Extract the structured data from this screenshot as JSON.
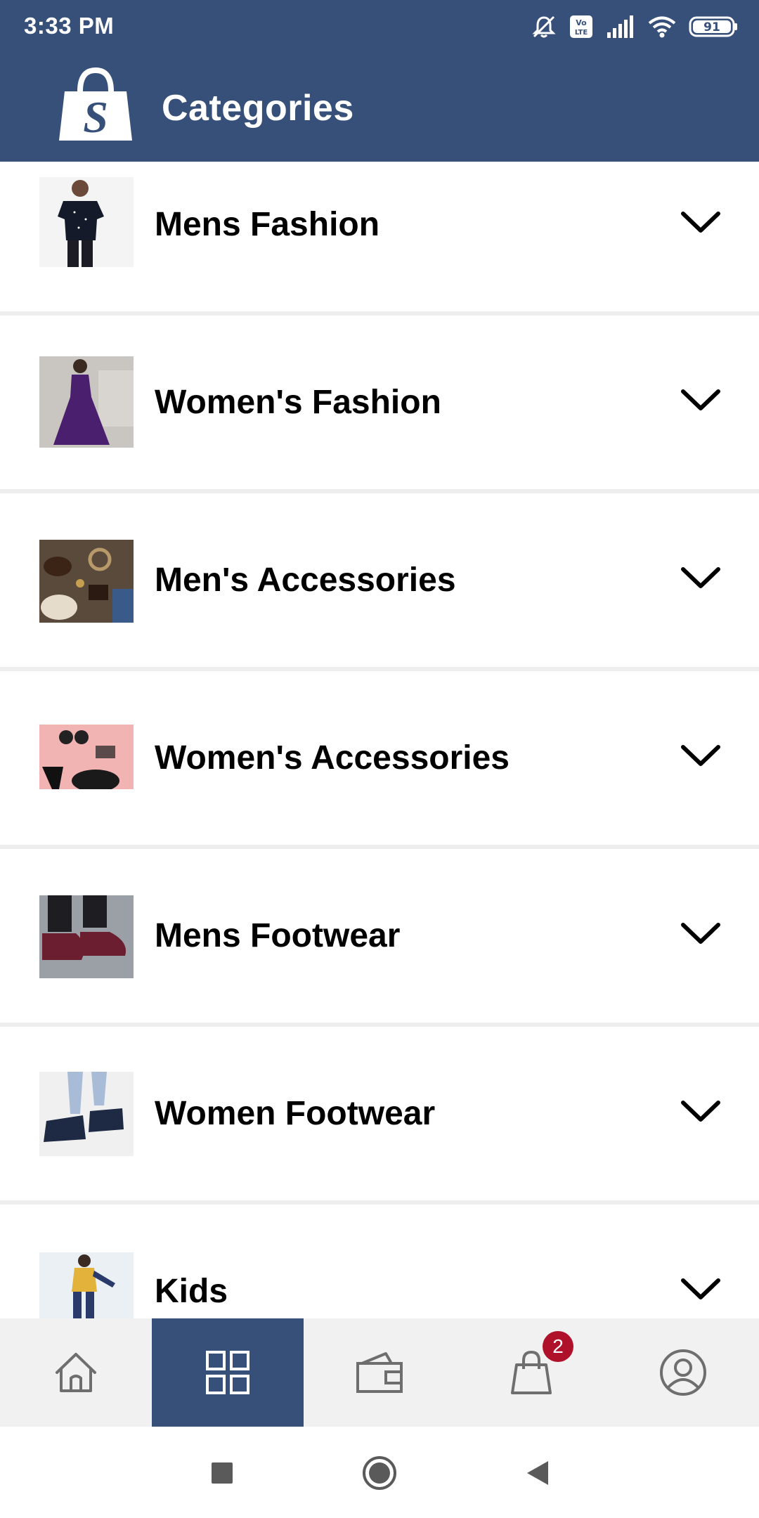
{
  "status_bar": {
    "time": "3:33 PM",
    "battery": "91",
    "icons": [
      "mute-bell-icon",
      "volte-icon",
      "signal-icon",
      "wifi-icon",
      "battery-icon"
    ]
  },
  "app_bar": {
    "title": "Categories",
    "logo_letter": "S"
  },
  "categories": [
    {
      "label": "Mens Fashion"
    },
    {
      "label": "Women's Fashion"
    },
    {
      "label": "Men's Accessories"
    },
    {
      "label": "Women's Accessories"
    },
    {
      "label": "Mens Footwear"
    },
    {
      "label": "Women Footwear"
    },
    {
      "label": "Kids"
    }
  ],
  "bottom_nav": {
    "items": [
      "home-icon",
      "categories-grid-icon",
      "wallet-icon",
      "shopping-bag-icon",
      "profile-icon"
    ],
    "active_index": 1,
    "cart_badge": "2"
  },
  "colors": {
    "primary": "#375079",
    "badge": "#b0112a",
    "nav_background": "#f1f1f1"
  }
}
